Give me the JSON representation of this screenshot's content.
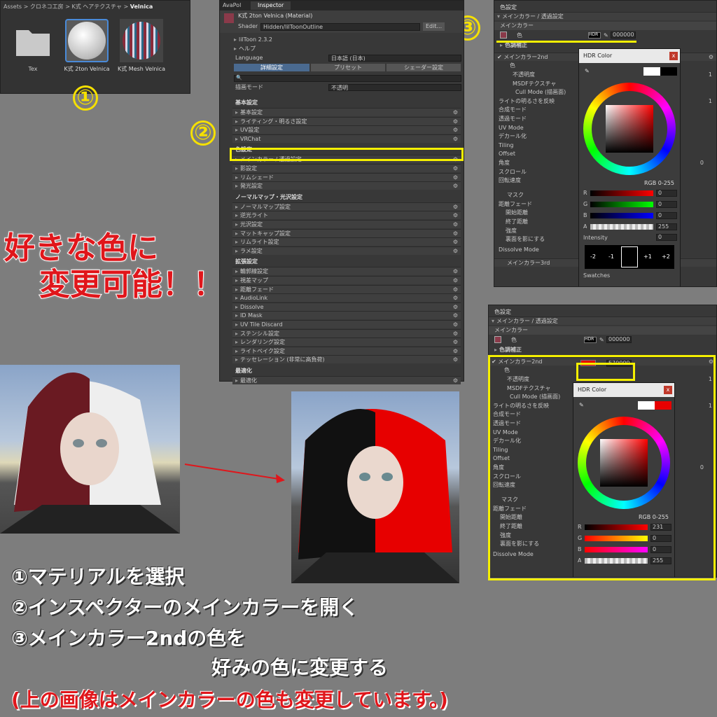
{
  "project": {
    "breadcrumb": [
      "Assets",
      "クロネコ工房",
      "K式 ヘアテクスチャ",
      "Velnica"
    ],
    "items": [
      {
        "label": "Tex",
        "kind": "folder"
      },
      {
        "label": "K式 2ton Velnica",
        "kind": "material-white"
      },
      {
        "label": "K式 Mesh Velnica",
        "kind": "material-pattern"
      }
    ]
  },
  "inspector": {
    "tabs": [
      "AvaPol",
      "Inspector"
    ],
    "material_name": "K式 2ton Velnica (Material)",
    "shader_label": "Shader",
    "shader_value": "Hidden/lilToonOutline",
    "edit_label": "Edit...",
    "version": "lilToon 2.3.2",
    "help": "ヘルプ",
    "language_label": "Language",
    "language_value": "日本語 (日本)",
    "mode_buttons": [
      "詳細設定",
      "プリセット",
      "シェーダー設定"
    ],
    "render_mode_label": "描画モード",
    "render_mode_value": "不透明",
    "groups": [
      {
        "title": "基本設定",
        "items": [
          "基本設定",
          "ライティング・明るさ設定",
          "UV設定",
          "VRChat"
        ]
      },
      {
        "title": "色設定",
        "items": [
          "メインカラー / 透過設定",
          "影設定",
          "リムシェード",
          "発光設定"
        ]
      },
      {
        "title": "ノーマルマップ・光沢設定",
        "items": [
          "ノーマルマップ設定",
          "逆光ライト",
          "光沢設定",
          "マットキャップ設定",
          "リムライト設定",
          "ラメ設定"
        ]
      },
      {
        "title": "拡張設定",
        "items": [
          "輪郭線設定",
          "視差マップ",
          "距離フェード",
          "AudioLink",
          "Dissolve",
          "ID Mask",
          "UV Tile Discard",
          "ステンシル設定",
          "レンダリング設定",
          "ライトベイク設定",
          "テッセレーション (非常に高負荷)"
        ]
      },
      {
        "title": "最適化",
        "items": [
          "最適化"
        ]
      }
    ]
  },
  "panel3": {
    "header": "色設定",
    "section": "メインカラー / 透過設定",
    "main_label": "メインカラー",
    "color_label": "色",
    "hdr": "HDR",
    "hex": "000000",
    "tone": "色調補正",
    "second": "メインカラー2nd",
    "second_color": "色",
    "rows": [
      "不透明度",
      "MSDFテクスチャ",
      "Cull Mode (描画面)",
      "ライトの明るさを反映",
      "合成モード",
      "透過モード",
      "UV Mode",
      "デカール化",
      "Tiling",
      "Offset",
      "角度",
      "スクロール",
      "回転速度"
    ],
    "mask": "マスク",
    "fade": [
      "距離フェード",
      "開始距離",
      "終了距離",
      "強度",
      "裏面を影にする"
    ],
    "dissolve": "Dissolve Mode",
    "third": "メインカラー3rd",
    "picker": {
      "title": "HDR Color",
      "mode": "RGB 0-255",
      "r": "0",
      "g": "0",
      "b": "0",
      "a": "255",
      "intensity_label": "Intensity",
      "intensity": "0",
      "exposure": [
        "-2",
        "-1",
        "+1",
        "+2"
      ],
      "swatches": "Swatches"
    }
  },
  "panel4": {
    "header": "色設定",
    "section": "メインカラー / 透過設定",
    "main_label": "メインカラー",
    "color_label": "色",
    "hdr": "HDR",
    "hex": "000000",
    "tone": "色調補正",
    "second": "メインカラー2nd",
    "second_color": "色",
    "hex2": "E70000",
    "rows": [
      "不透明度",
      "MSDFテクスチャ",
      "Cull Mode (描画面)",
      "ライトの明るさを反映",
      "合成モード",
      "透過モード",
      "UV Mode",
      "デカール化",
      "Tiling",
      "Offset",
      "角度",
      "スクロール",
      "回転速度"
    ],
    "mask": "マスク",
    "fade": [
      "距離フェード",
      "開始距離",
      "終了距離",
      "強度",
      "裏面を影にする"
    ],
    "dissolve": "Dissolve Mode",
    "picker": {
      "title": "HDR Color",
      "mode": "RGB 0-255",
      "r": "231",
      "g": "0",
      "b": "0",
      "a": "255"
    }
  },
  "slider_values": {
    "one": "1",
    "zero": "0"
  },
  "callouts": {
    "badge1": "①",
    "badge2": "②",
    "badge3": "③",
    "headline1": "好きな色に",
    "headline2": "変更可能！！"
  },
  "steps": [
    "①マテリアルを選択",
    "②インスペクターのメインカラーを開く",
    "③メインカラー2ndの色を",
    "好みの色に変更する"
  ],
  "note": "(上の画像はメインカラーの色も変更しています。)",
  "colors": {
    "highlight": "#f5ef00",
    "red": "#e70000",
    "panel": "#383838"
  }
}
